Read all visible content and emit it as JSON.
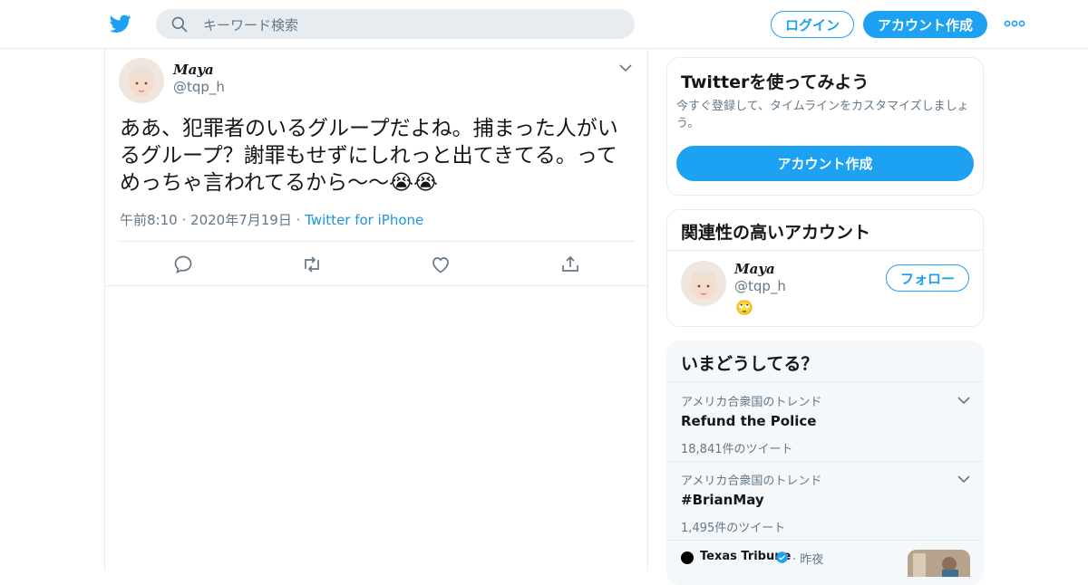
{
  "header": {
    "search_placeholder": "キーワード検索",
    "login_label": "ログイン",
    "signup_label": "アカウント作成"
  },
  "tweet": {
    "display_name": "𝑴𝒂𝒚𝒂",
    "handle": "@tqp_h",
    "text": "ああ、犯罪者のいるグループだよね。捕まった人がいるグループ？謝罪もせずにしれっと出てきてる。ってめっちゃ言われてるから〜〜😭😭",
    "time": "午前8:10",
    "date": "2020年7月19日",
    "source": "Twitter for iPhone",
    "sep": "·"
  },
  "sidebar": {
    "signup_card": {
      "title": "Twitterを使ってみよう",
      "description": "今すぐ登録して、タイムラインをカスタマイズしましょう。",
      "button_label": "アカウント作成"
    },
    "related": {
      "title": "関連性の高いアカウント",
      "account": {
        "display_name": "𝑴𝒂𝒚𝒂",
        "handle": "@tqp_h",
        "bio_emoji": "🙄",
        "follow_label": "フォロー"
      }
    },
    "trends": {
      "title": "いまどうしてる？",
      "items": [
        {
          "context": "アメリカ合衆国のトレンド",
          "name": "Refund the Police",
          "count": "18,841件のツイート"
        },
        {
          "context": "アメリカ合衆国のトレンド",
          "name": "#BrianMay",
          "count": "1,495件のツイート"
        }
      ],
      "news": {
        "source": "Texas Tribune",
        "time": "昨夜",
        "sep": "·"
      }
    }
  },
  "colors": {
    "accent": "#1da1f2",
    "link": "#1b95e0",
    "muted": "#657786",
    "border": "#e6ecf0"
  },
  "icons": [
    "twitter-bird-icon",
    "search-icon",
    "more-icon",
    "chevron-down-icon",
    "reply-icon",
    "retweet-icon",
    "like-icon",
    "share-icon",
    "verified-icon"
  ]
}
